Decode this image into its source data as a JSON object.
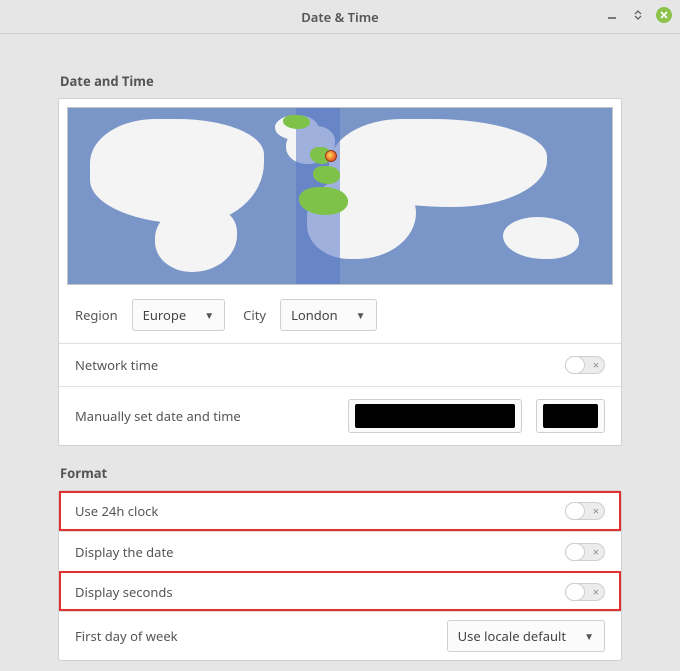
{
  "window": {
    "title": "Date & Time"
  },
  "datetime": {
    "section_title": "Date and Time",
    "region_label": "Region",
    "region_value": "Europe",
    "city_label": "City",
    "city_value": "London",
    "network_time_label": "Network time",
    "manual_label": "Manually set date and time"
  },
  "format": {
    "section_title": "Format",
    "use_24h_label": "Use 24h clock",
    "display_date_label": "Display the date",
    "display_seconds_label": "Display seconds",
    "first_day_label": "First day of week",
    "first_day_value": "Use locale default"
  },
  "toggles": {
    "network_time": false,
    "use_24h": false,
    "display_date": false,
    "display_seconds": false
  }
}
